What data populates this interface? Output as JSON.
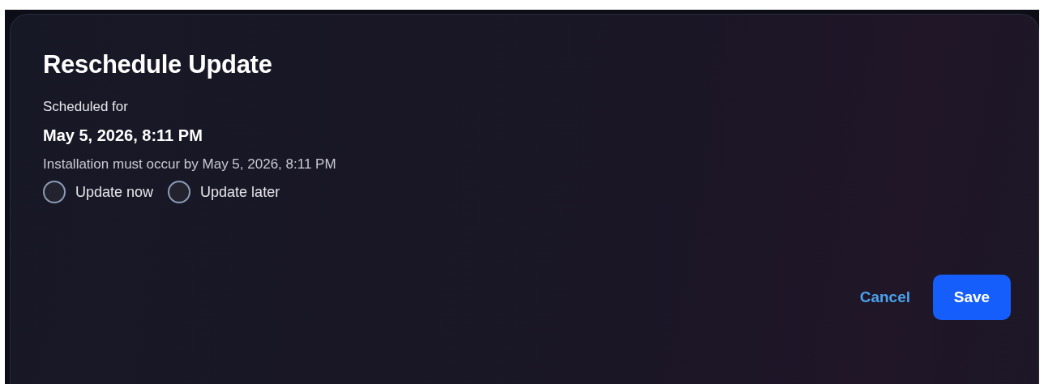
{
  "dialog": {
    "title": "Reschedule Update",
    "scheduled_label": "Scheduled for",
    "scheduled_time": "May 5, 2026, 8:11 PM",
    "deadline_note": "Installation must occur by May 5, 2026, 8:11 PM",
    "options": [
      {
        "label": "Update now",
        "selected": false
      },
      {
        "label": "Update later",
        "selected": false
      }
    ],
    "buttons": [
      {
        "label": "Cancel",
        "kind": "link"
      },
      {
        "label": "Save",
        "kind": "primary"
      }
    ]
  }
}
